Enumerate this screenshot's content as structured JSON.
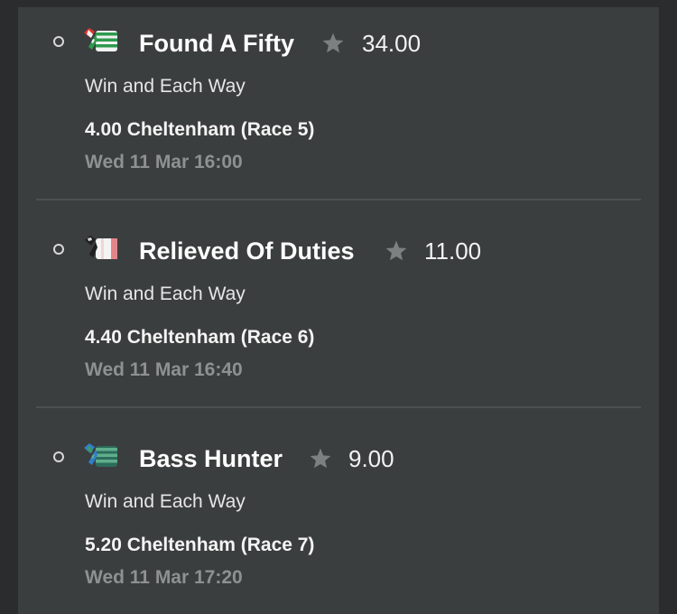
{
  "colors": {
    "panel_background": "#3b3e3e",
    "outer_background": "#2a2c2d",
    "divider": "#4d5151",
    "star": "#7d8080",
    "muted_text": "#8e9192"
  },
  "selections": [
    {
      "silks_icon": "silks-green-white-hoops-icon",
      "horse": "Found A Fifty",
      "favourite_icon": "star-icon",
      "odds": "34.00",
      "bet_type": "Win and Each Way",
      "race": "4.00 Cheltenham (Race 5)",
      "datetime": "Wed 11 Mar 16:00"
    },
    {
      "silks_icon": "silks-white-red-halves-icon",
      "horse": "Relieved Of Duties",
      "favourite_icon": "star-icon",
      "odds": "11.00",
      "bet_type": "Win and Each Way",
      "race": "4.40 Cheltenham (Race 6)",
      "datetime": "Wed 11 Mar 16:40"
    },
    {
      "silks_icon": "silks-blue-green-hoops-icon",
      "horse": "Bass Hunter",
      "favourite_icon": "star-icon",
      "odds": "9.00",
      "bet_type": "Win and Each Way",
      "race": "5.20 Cheltenham (Race 7)",
      "datetime": "Wed 11 Mar 17:20"
    }
  ]
}
